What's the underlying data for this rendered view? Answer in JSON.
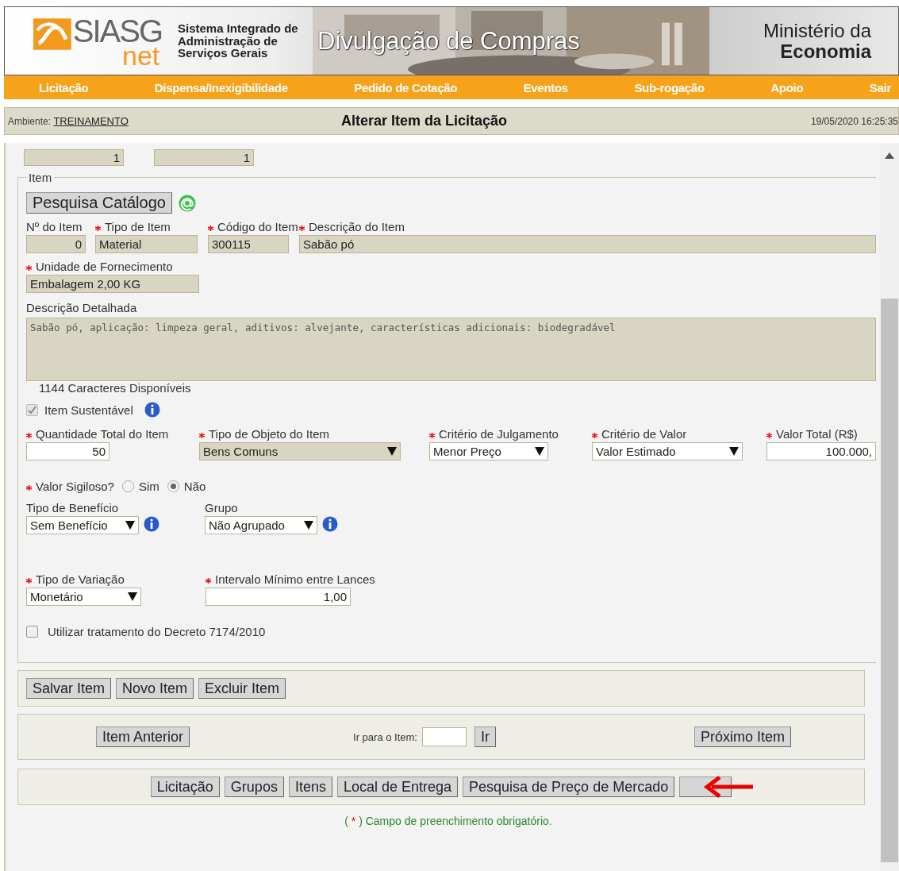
{
  "header": {
    "logo": {
      "name": "SIASG",
      "sub": "net"
    },
    "system_name": [
      "Sistema Integrado de",
      "Administração de",
      "Serviços Gerais"
    ],
    "banner_title": "Divulgação de Compras",
    "ministry": [
      "Ministério da",
      "Economia"
    ]
  },
  "nav": [
    "Licitação",
    "Dispensa/Inexigibilidade",
    "Pedido de Cotação",
    "Eventos",
    "Sub-rogação",
    "Apoio",
    "Sair"
  ],
  "title_bar": {
    "env_label": "Ambiente:",
    "env_link": "TREINAMENTO",
    "title": "Alterar Item da Licitação",
    "datetime": "19/05/2020 16:25:35"
  },
  "top_fields": [
    "1",
    "1"
  ],
  "item": {
    "legend": "Item",
    "catalog_button": "Pesquisa Catálogo",
    "id_row": [
      {
        "label": "Nº do Item",
        "required": false,
        "kind": "readonly",
        "value": "0"
      },
      {
        "label": "Tipo de Item",
        "required": true,
        "kind": "readonly",
        "value": "Material"
      },
      {
        "label": "Código do Item",
        "required": true,
        "kind": "readonly",
        "value": "300115"
      },
      {
        "label": "Descrição do Item",
        "required": true,
        "kind": "readonly",
        "value": "Sabão pó"
      }
    ],
    "unit": {
      "label": "Unidade de Fornecimento",
      "required": true,
      "kind": "readonly",
      "value": "Embalagem 2,00 KG"
    },
    "detail": {
      "label": "Descrição Detalhada",
      "value": "Sabão pó, aplicação: limpeza geral, aditivos: alvejante, características adicionais: biodegradável"
    },
    "chars_left": "1144 Caracteres Disponíveis",
    "sustainable": {
      "label": "Item Sustentável",
      "checked": true,
      "disabled": true
    },
    "value_row": [
      {
        "label": "Quantidade Total do Item",
        "required": true,
        "kind": "input",
        "value": "50"
      },
      {
        "label": "Tipo de Objeto do Item",
        "required": true,
        "kind": "select_readonly",
        "value": "Bens Comuns"
      },
      {
        "label": "Critério de Julgamento",
        "required": true,
        "kind": "select",
        "value": "Menor Preço"
      },
      {
        "label": "Critério de Valor",
        "required": true,
        "kind": "select",
        "value": "Valor Estimado"
      },
      {
        "label": "Valor Total (R$)",
        "required": true,
        "kind": "input",
        "value": "100.000,"
      }
    ],
    "secret": {
      "label": "Valor Sigiloso?",
      "required": true,
      "options": [
        {
          "label": "Sim",
          "selected": false
        },
        {
          "label": "Não",
          "selected": true
        }
      ]
    },
    "benefit_row": [
      {
        "label": "Tipo de Benefício",
        "required": false,
        "kind": "select",
        "value": "Sem Benefício",
        "info": true
      },
      {
        "label": "Grupo",
        "required": false,
        "kind": "select",
        "value": "Não Agrupado",
        "info": true
      }
    ],
    "variation_row": [
      {
        "label": "Tipo de Variação",
        "required": true,
        "kind": "select",
        "value": "Monetário"
      },
      {
        "label": "Intervalo Mínimo entre Lances",
        "required": true,
        "kind": "input",
        "value": "1,00"
      }
    ],
    "decree": {
      "label": "Utilizar tratamento do Decreto 7174/2010",
      "checked": false
    }
  },
  "actions": [
    "Salvar Item",
    "Novo Item",
    "Excluir Item"
  ],
  "navigation": {
    "previous": "Item Anterior",
    "goto_label": "Ir para o Item:",
    "goto_button": "Ir",
    "next": "Próximo Item"
  },
  "sections": [
    "Licitação",
    "Grupos",
    "Itens",
    "Local de Entrega",
    "Pesquisa de Preço de Mercado"
  ],
  "required_note": {
    "prefix": "( ",
    "mark": "*",
    "text": " ) Campo de preenchimento obrigatório."
  }
}
